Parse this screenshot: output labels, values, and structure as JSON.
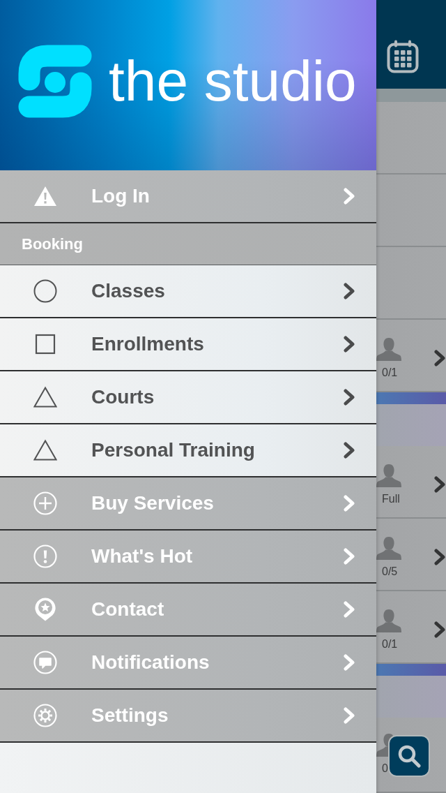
{
  "drawer": {
    "brand": "the studio",
    "menu": [
      {
        "kind": "link",
        "label": "Log In"
      },
      {
        "kind": "section",
        "label": "Booking",
        "items": [
          {
            "label": "Classes"
          },
          {
            "label": "Enrollments"
          },
          {
            "label": "Courts"
          },
          {
            "label": "Personal Training"
          }
        ]
      },
      {
        "kind": "link",
        "label": "Buy Services"
      },
      {
        "kind": "link",
        "label": "What's Hot"
      },
      {
        "kind": "link",
        "label": "Contact"
      },
      {
        "kind": "link",
        "label": "Notifications"
      },
      {
        "kind": "link",
        "label": "Settings"
      }
    ]
  },
  "class_list": [
    {
      "kind": "row"
    },
    {
      "kind": "row"
    },
    {
      "kind": "row"
    },
    {
      "kind": "row",
      "spots": "0/1"
    },
    {
      "kind": "header"
    },
    {
      "kind": "row",
      "spots": "Full"
    },
    {
      "kind": "row",
      "spots": "0/5"
    },
    {
      "kind": "row",
      "spots": "0/1"
    },
    {
      "kind": "header"
    },
    {
      "kind": "row",
      "spots": "0"
    }
  ]
}
